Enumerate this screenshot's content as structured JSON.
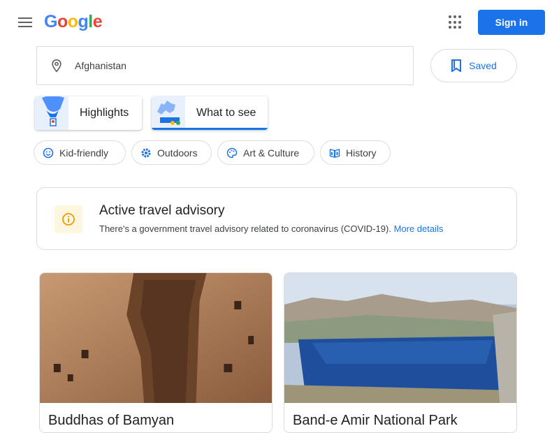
{
  "header": {
    "logo_letters": [
      {
        "ch": "G",
        "color": "#4285F4"
      },
      {
        "ch": "o",
        "color": "#EA4335"
      },
      {
        "ch": "o",
        "color": "#FBBC05"
      },
      {
        "ch": "g",
        "color": "#4285F4"
      },
      {
        "ch": "l",
        "color": "#34A853"
      },
      {
        "ch": "e",
        "color": "#EA4335"
      }
    ],
    "signin_label": "Sign in"
  },
  "search": {
    "value": "Afghanistan"
  },
  "saved_label": "Saved",
  "tabs": [
    {
      "label": "Highlights",
      "active": false
    },
    {
      "label": "What to see",
      "active": true
    }
  ],
  "chips": [
    {
      "label": "Kid-friendly",
      "icon": "smile-icon"
    },
    {
      "label": "Outdoors",
      "icon": "gear-flower-icon"
    },
    {
      "label": "Art & Culture",
      "icon": "palette-icon"
    },
    {
      "label": "History",
      "icon": "book-icon"
    }
  ],
  "advisory": {
    "title": "Active travel advisory",
    "body": "There's a government travel advisory related to coronavirus (COVID-19).",
    "link": "More details",
    "icon": "info-icon",
    "icon_color": "#f29900"
  },
  "places": [
    {
      "title": "Buddhas of Bamyan"
    },
    {
      "title": "Band-e Amir National Park"
    }
  ],
  "colors": {
    "accent": "#1a73e8",
    "border": "#dadce0"
  }
}
